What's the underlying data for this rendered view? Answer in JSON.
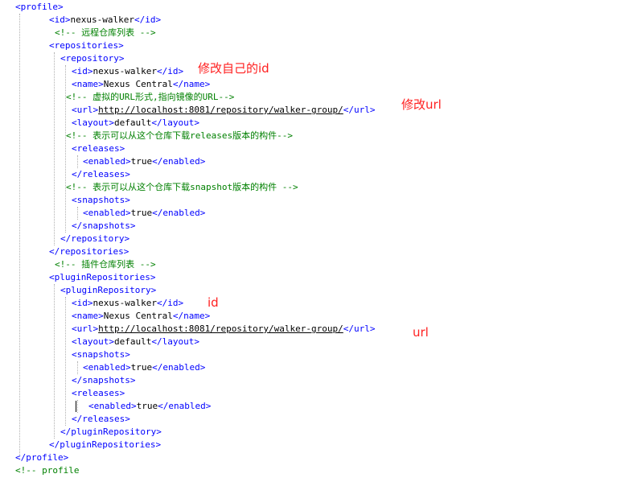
{
  "lines": [
    "<profile>",
    "<id>nexus-walker</id>",
    "<!-- 远程仓库列表 -->",
    "<repositories>",
    "<repository>",
    "<id>nexus-walker</id>",
    "<name>Nexus Central</name>",
    "<!-- 虚拟的URL形式,指向镜像的URL-->",
    "<url>http://localhost:8081/repository/walker-group/</url>",
    "<layout>default</layout>",
    "<!-- 表示可以从这个仓库下载releases版本的构件-->",
    "<releases>",
    "<enabled>true</enabled>",
    "</releases>",
    "<!-- 表示可以从这个仓库下载snapshot版本的构件 -->",
    "<snapshots>",
    "<enabled>true</enabled>",
    "</snapshots>",
    "</repository>",
    "</repositories>",
    "<!-- 插件仓库列表 -->",
    "<pluginRepositories>",
    "<pluginRepository>",
    "<id>nexus-walker</id>",
    "<name>Nexus Central</name>",
    "<url>http://localhost:8081/repository/walker-group/</url>",
    "<layout>default</layout>",
    "<snapshots>",
    "<enabled>true</enabled>",
    "</snapshots>",
    "<releases>",
    "<enabled>true</enabled>",
    "</releases>",
    "</pluginRepository>",
    "</pluginRepositories>",
    "</profile>",
    "<!-- profile"
  ],
  "annotations": {
    "modify_id": "修改自己的id",
    "modify_url": "修改url",
    "id": "id",
    "url": "url"
  },
  "colors": {
    "tag": "#0000ff",
    "text": "#000000",
    "comment": "#008000",
    "annotation": "#ff2020",
    "indent_guide": "#b0b0b0"
  }
}
